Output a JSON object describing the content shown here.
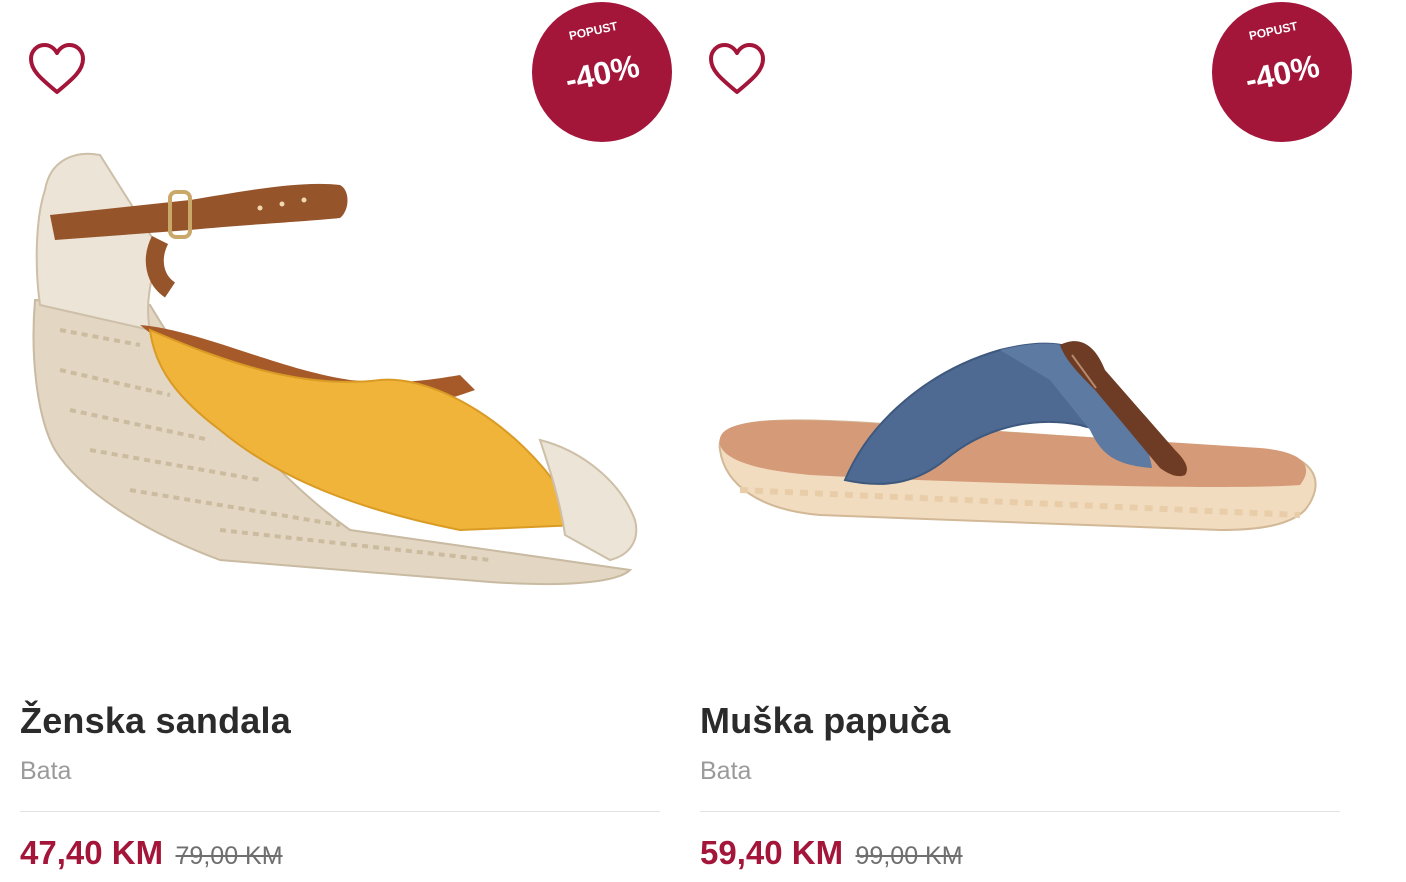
{
  "colors": {
    "accent": "#a3163a",
    "title": "#2b2b2b",
    "brand_text": "#9a9a9a",
    "old_price": "#6f6f6f"
  },
  "products": [
    {
      "title": "Ženska sandala",
      "brand": "Bata",
      "price": "47,40 KM",
      "old_price": "79,00 KM",
      "badge": {
        "label": "POPUST",
        "discount": "-40%"
      },
      "wishlist_icon": "heart-outline-icon",
      "image": "yellow-espadrille-wedge-sandal"
    },
    {
      "title": "Muška papuča",
      "brand": "Bata",
      "price": "59,40 KM",
      "old_price": "99,00 KM",
      "badge": {
        "label": "POPUST",
        "discount": "-40%"
      },
      "wishlist_icon": "heart-outline-icon",
      "image": "blue-canvas-flip-flop"
    }
  ]
}
